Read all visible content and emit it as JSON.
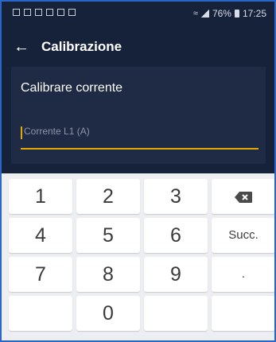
{
  "status": {
    "battery": "76%",
    "time": "17:25"
  },
  "appbar": {
    "title": "Calibrazione"
  },
  "form": {
    "label": "Calibrare corrente",
    "placeholder": "Corrente L1 (A)",
    "value": ""
  },
  "keypad": {
    "k1": "1",
    "k2": "2",
    "k3": "3",
    "k4": "4",
    "k5": "5",
    "k6": "6",
    "k7": "7",
    "k8": "8",
    "k9": "9",
    "k0": "0",
    "next": "Succ.",
    "dot": "."
  },
  "colors": {
    "background": "#16213a",
    "card": "#1f2b44",
    "accent": "#e5a700",
    "keypad": "#eceef1"
  }
}
